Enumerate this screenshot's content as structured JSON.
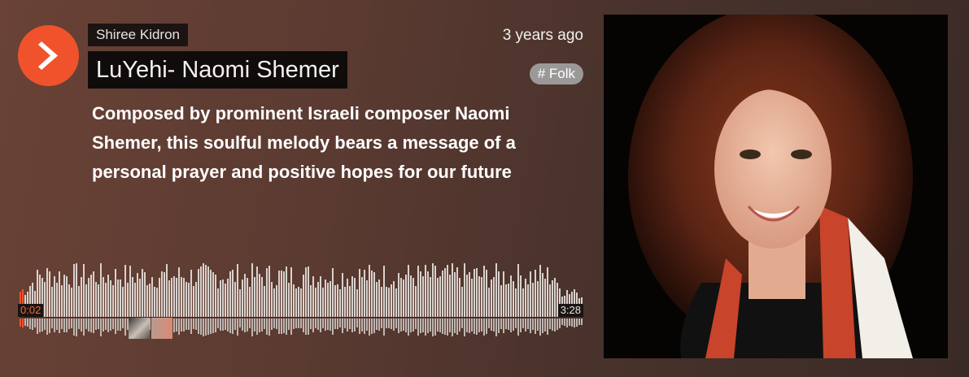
{
  "player": {
    "user_name": "Shiree Kidron",
    "track_title": "LuYehi- Naomi Shemer",
    "posted": "3 years ago",
    "tag": "# Folk",
    "description": "Composed by prominent Israeli composer Naomi Shemer, this soulful melody bears a message of a personal prayer and positive hopes for our future",
    "current_time": "0:02",
    "duration": "3:28",
    "progress_fraction": 0.01,
    "accent_color": "#f0532c",
    "icons": {
      "play": "play-icon"
    }
  }
}
